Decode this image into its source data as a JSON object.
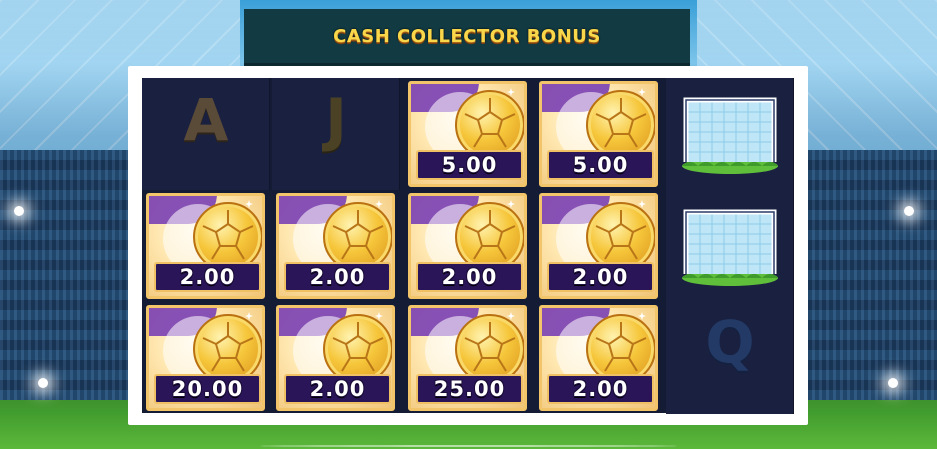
{
  "banner": {
    "title": "CASH COLLECTOR BONUS"
  },
  "reels": {
    "row1": {
      "c1": {
        "type": "letter",
        "symbol": "A"
      },
      "c2": {
        "type": "letter",
        "symbol": "J"
      },
      "c3": {
        "type": "coin",
        "value": "5.00"
      },
      "c4": {
        "type": "coin",
        "value": "5.00"
      },
      "c5": {
        "type": "goal",
        "icon": "goal-icon"
      }
    },
    "row2": {
      "c1": {
        "type": "coin",
        "value": "2.00"
      },
      "c2": {
        "type": "coin",
        "value": "2.00"
      },
      "c3": {
        "type": "coin",
        "value": "2.00"
      },
      "c4": {
        "type": "coin",
        "value": "2.00"
      },
      "c5": {
        "type": "goal",
        "icon": "goal-icon"
      }
    },
    "row3": {
      "c1": {
        "type": "coin",
        "value": "20.00"
      },
      "c2": {
        "type": "coin",
        "value": "2.00"
      },
      "c3": {
        "type": "coin",
        "value": "25.00"
      },
      "c4": {
        "type": "coin",
        "value": "2.00"
      },
      "c5": {
        "type": "letter",
        "symbol": "Q"
      }
    }
  },
  "colors": {
    "banner_bg": "#123a43",
    "banner_text": "#f8d84a",
    "value_box": "#2a1559",
    "coin_gold": "#f6c63a"
  }
}
